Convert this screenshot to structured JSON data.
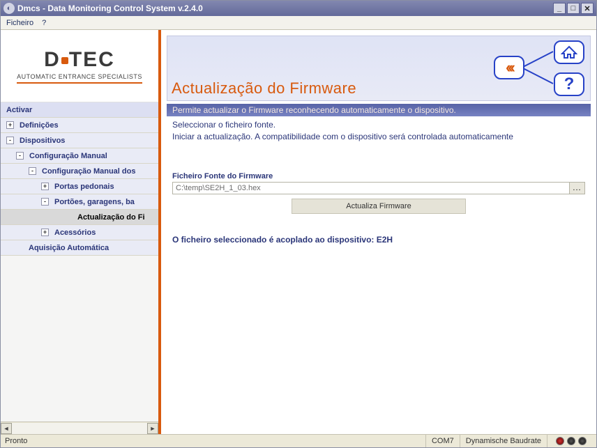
{
  "window_title": "Dmcs - Data Monitoring Control System v.2.4.0",
  "menu": {
    "ficheiro": "Ficheiro",
    "help": "?"
  },
  "logo": {
    "brand": "DITEC",
    "subtitle": "AUTOMATIC ENTRANCE SPECIALISTS"
  },
  "nav": {
    "activar": "Activar",
    "definicoes": "Definições",
    "dispositivos": "Dispositivos",
    "config_manual": "Configuração Manual",
    "config_manual_dos": "Configuração Manual dos",
    "portas_pedonais": "Portas pedonais",
    "portoes_garagens": "Portões, garagens, ba",
    "actualizacao_fi": "Actualização do Fi",
    "acessorios": "Acessórios",
    "aquisicao_auto": "Aquisição Automática"
  },
  "hero": {
    "title": "Actualização do Firmware",
    "back": "‹‹‹",
    "help": "?"
  },
  "desc": {
    "line1": "Permite actualizar o Firmware reconhecendo automaticamente o dispositivo.",
    "line2": "Seleccionar o ficheiro fonte.",
    "line3": "Iniciar a actualização. A compatibilidade com o dispositivo será controlada automaticamente"
  },
  "form": {
    "file_label": "Ficheiro Fonte do Firmware",
    "file_value": "C:\\temp\\SE2H_1_03.hex",
    "browse": "...",
    "update_btn": "Actualiza Firmware",
    "result": "O ficheiro seleccionado é acoplado ao dispositivo: E2H"
  },
  "status": {
    "ready": "Pronto",
    "port": "COM7",
    "baud": "Dynamische Baudrate"
  }
}
